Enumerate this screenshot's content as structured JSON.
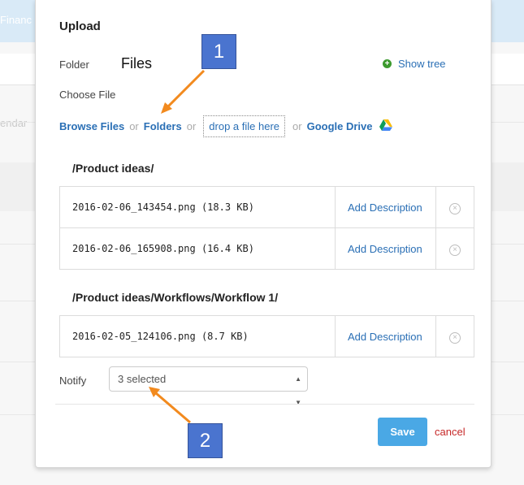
{
  "background": {
    "header_text": "Financ",
    "nav_text": "endar"
  },
  "modal": {
    "title": "Upload",
    "folder_label": "Folder",
    "folder_value": "Files",
    "show_tree_label": "Show tree",
    "choose_file_label": "Choose File",
    "browse_files_label": "Browse Files",
    "or_text": "or",
    "folders_label": "Folders",
    "drop_label": "drop a file here",
    "google_drive_label": "Google Drive",
    "groups": [
      {
        "path": "/Product ideas/",
        "files": [
          {
            "name": "2016-02-06_143454.png (18.3 KB)",
            "action": "Add Description"
          },
          {
            "name": "2016-02-06_165908.png (16.4 KB)",
            "action": "Add Description"
          }
        ]
      },
      {
        "path": "/Product ideas/Workflows/Workflow 1/",
        "files": [
          {
            "name": "2016-02-05_124106.png (8.7 KB)",
            "action": "Add Description"
          }
        ]
      }
    ],
    "notify_label": "Notify",
    "notify_value": "3 selected",
    "save_label": "Save",
    "cancel_label": "cancel"
  },
  "annotations": {
    "badge1": "1",
    "badge2": "2"
  },
  "colors": {
    "link": "#2a6fb5",
    "save_button": "#4aa8e5",
    "cancel": "#c62828",
    "arrow": "#f28a1e",
    "badge": "#4a74cf"
  },
  "icons": [
    "plus-circle-icon",
    "google-drive-icon",
    "remove-circle-icon",
    "select-caret-icon"
  ]
}
